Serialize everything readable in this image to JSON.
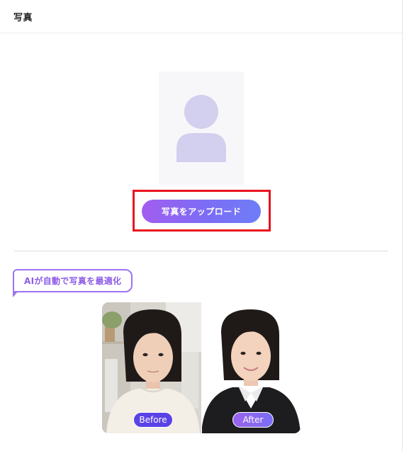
{
  "header": {
    "title": "写真"
  },
  "upload": {
    "button_label": "写真をアップロード"
  },
  "ai_badge": {
    "label": "AIが自動で写真を最適化"
  },
  "comparison": {
    "before_label": "Before",
    "after_label": "After"
  },
  "colors": {
    "accent_start": "#a25df0",
    "accent_end": "#6f7df7",
    "highlight": "#e8141e",
    "placeholder_silhouette": "#d3cfee"
  }
}
